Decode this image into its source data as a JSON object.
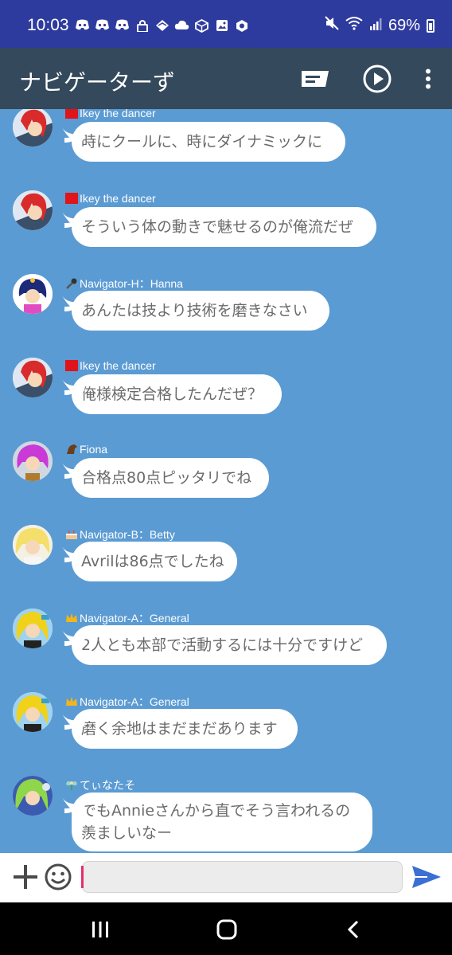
{
  "status_bar": {
    "time": "10:03",
    "battery": "69%",
    "notification_icons": [
      "discord-icon",
      "discord-icon",
      "discord-icon",
      "lock-icon",
      "messenger-icon",
      "cloud-icon",
      "box-icon",
      "image-icon",
      "app-icon"
    ],
    "system_icons": [
      "mute-icon",
      "wifi-icon",
      "signal-icon",
      "battery-icon"
    ]
  },
  "app_bar": {
    "title": "ナビゲーターず",
    "actions": [
      "message-icon",
      "play-icon",
      "more-vert-icon"
    ]
  },
  "messages": [
    {
      "sender": "Ikey the dancer",
      "badge": "red-square",
      "avatar": "red-hair-avatar",
      "text": "時にクールに、時にダイナミックに"
    },
    {
      "sender": "Ikey the dancer",
      "badge": "red-square",
      "avatar": "red-hair-avatar",
      "text": "そういう体の動きで魅せるのが俺流だぜ"
    },
    {
      "sender": "Navigator-H：Hanna",
      "badge": "microphone",
      "avatar": "navy-hair-avatar",
      "text": "あんたは技より技術を磨きなさい"
    },
    {
      "sender": "Ikey the dancer",
      "badge": "red-square",
      "avatar": "red-hair-avatar",
      "text": "俺様検定合格したんだぜ？"
    },
    {
      "sender": "Fiona",
      "badge": "horse",
      "avatar": "pink-hair-avatar",
      "text": "合格点80点ピッタリでね"
    },
    {
      "sender": "Navigator-B：Betty",
      "badge": "cake",
      "avatar": "blonde-avatar",
      "text": "Avrilは86点でしたね"
    },
    {
      "sender": "Navigator-A：General",
      "badge": "crown",
      "avatar": "yellow-hair-avatar",
      "text": "2人とも本部で活動するには十分ですけど"
    },
    {
      "sender": "Navigator-A：General",
      "badge": "crown",
      "avatar": "yellow-hair-avatar",
      "text": "磨く余地はまだまだあります"
    },
    {
      "sender": "てぃなたそ",
      "badge": "fairy",
      "avatar": "green-hair-avatar",
      "text": "でもAnnieさんから直でそう言われるの羨ましいなー"
    }
  ],
  "input_bar": {
    "value": "",
    "placeholder": ""
  },
  "colors": {
    "status_bar": "#2e3b9e",
    "app_bar": "#34495b",
    "chat_background": "#5b9bd3",
    "send_accent": "#3a6fd4"
  }
}
